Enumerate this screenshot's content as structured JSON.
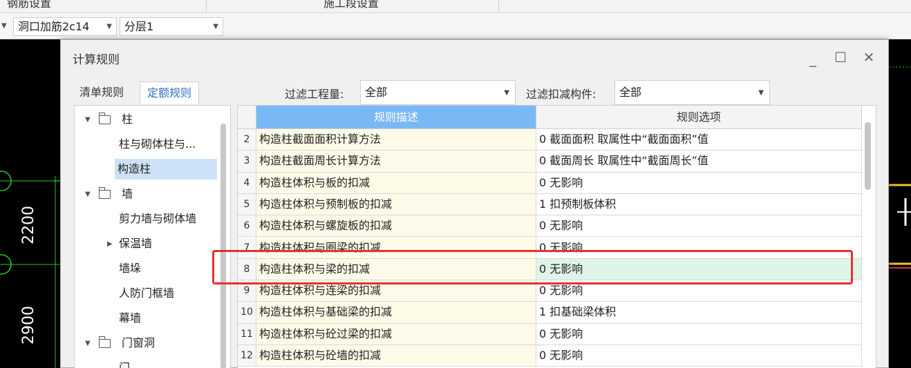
{
  "top_strip": {
    "left_label": "钢筋设置",
    "right_label": "施工段设置"
  },
  "toolbar": {
    "combo1": "洞口加筋2c14",
    "combo2": "分层1"
  },
  "cad": {
    "dim1": "2200",
    "dim2": "2900"
  },
  "dialog": {
    "title": "计算规则",
    "tabs": [
      "清单规则",
      "定额规则"
    ],
    "filter_quantity_label": "过滤工程量:",
    "filter_quantity_value": "全部",
    "filter_deduct_label": "过滤扣减构件:",
    "filter_deduct_value": "全部"
  },
  "tree": [
    {
      "label": "柱",
      "kind": "folder",
      "expanded": true
    },
    {
      "label": "柱与砌体柱与...",
      "kind": "leaf"
    },
    {
      "label": "构造柱",
      "kind": "leaf",
      "selected": true
    },
    {
      "label": "墙",
      "kind": "folder",
      "expanded": true
    },
    {
      "label": "剪力墙与砌体墙",
      "kind": "leaf"
    },
    {
      "label": "保温墙",
      "kind": "group",
      "expanded": false
    },
    {
      "label": "墙垛",
      "kind": "leaf"
    },
    {
      "label": "人防门框墙",
      "kind": "leaf"
    },
    {
      "label": "幕墙",
      "kind": "leaf"
    },
    {
      "label": "门窗洞",
      "kind": "folder",
      "expanded": true
    },
    {
      "label": "门",
      "kind": "leaf"
    }
  ],
  "table": {
    "headers": {
      "desc": "规则描述",
      "option": "规则选项"
    },
    "rows": [
      {
        "num": "2",
        "desc": "构造柱截面面积计算方法",
        "option": "0 截面面积   取属性中“截面面积”值"
      },
      {
        "num": "3",
        "desc": "构造柱截面周长计算方法",
        "option": "0 截面周长   取属性中“截面周长”值"
      },
      {
        "num": "4",
        "desc": "构造柱体积与板的扣减",
        "option": "0  无影响"
      },
      {
        "num": "5",
        "desc": "构造柱体积与预制板的扣减",
        "option": "1 扣预制板体积"
      },
      {
        "num": "6",
        "desc": "构造柱体积与螺旋板的扣减",
        "option": "0  无影响"
      },
      {
        "num": "7",
        "desc": "构造柱体积与圈梁的扣减",
        "option": "0  无影响"
      },
      {
        "num": "8",
        "desc": "构造柱体积与梁的扣减",
        "option": "0  无影响",
        "highlight": true
      },
      {
        "num": "9",
        "desc": "构造柱体积与连梁的扣减",
        "option": "0  无影响"
      },
      {
        "num": "10",
        "desc": "构造柱体积与基础梁的扣减",
        "option": "1 扣基础梁体积"
      },
      {
        "num": "11",
        "desc": "构造柱体积与砼过梁的扣减",
        "option": "0  无影响"
      },
      {
        "num": "12",
        "desc": "构造柱体积与砼墙的扣减",
        "option": "0  无影响"
      }
    ]
  }
}
